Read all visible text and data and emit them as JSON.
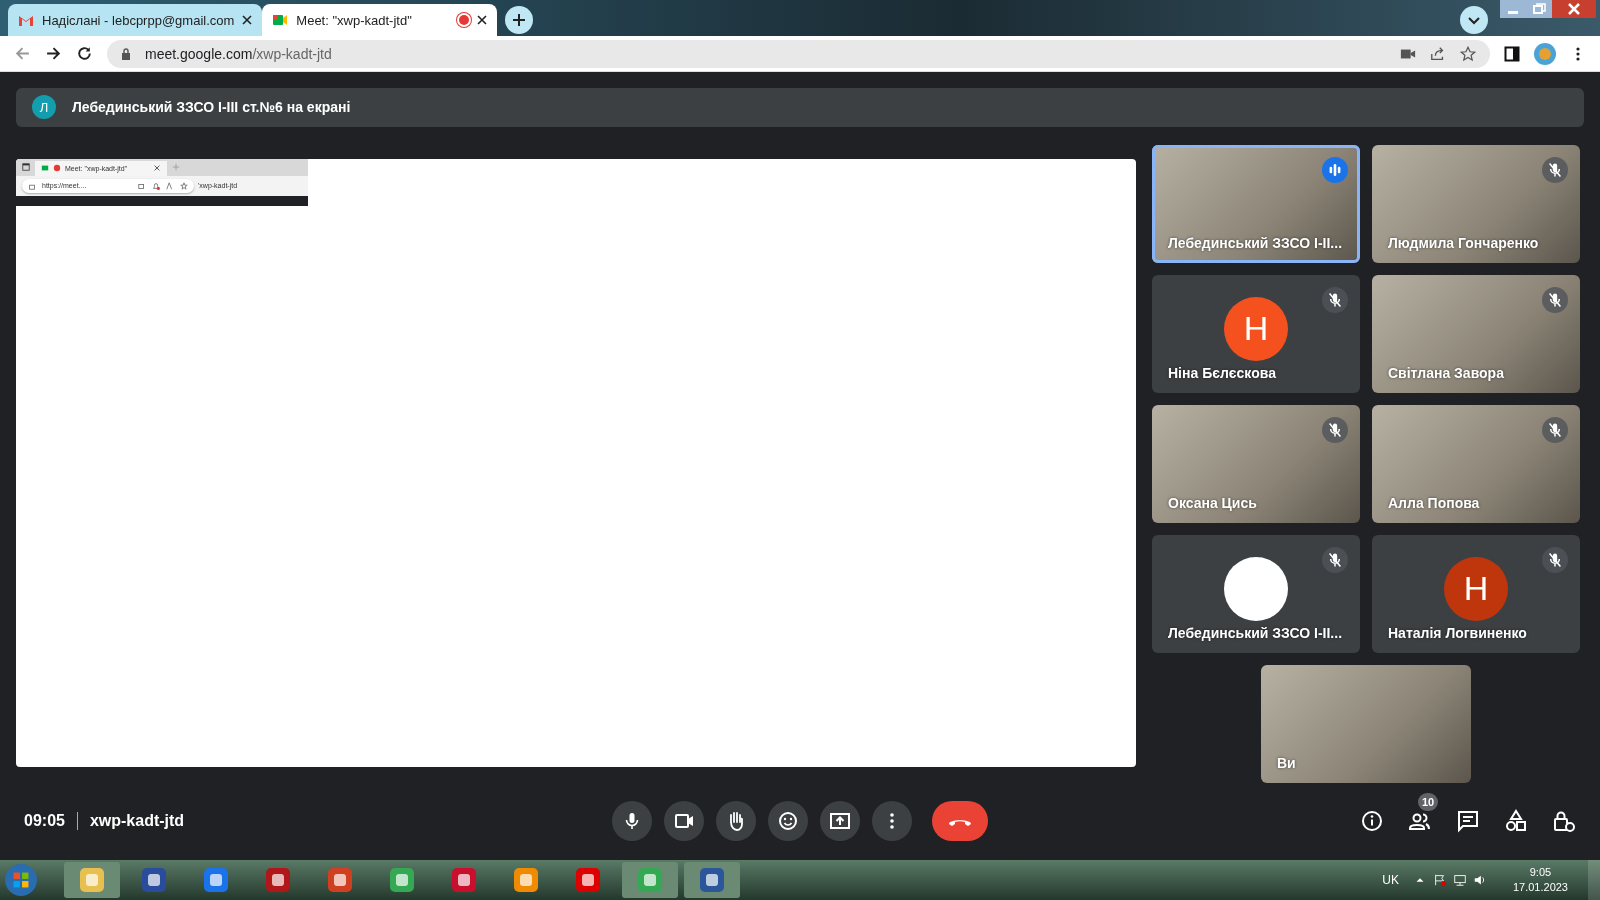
{
  "browser": {
    "tabs": [
      {
        "title": "Надіслані - lebcprpp@gmail.com",
        "kind": "mail",
        "recording": false,
        "selected": false
      },
      {
        "title": "Meet: \"xwp-kadt-jtd\"",
        "kind": "meet",
        "recording": true,
        "selected": true
      }
    ],
    "url_host": "meet.google.com",
    "url_path": "/xwp-kadt-jtd"
  },
  "presenting_banner": {
    "initial": "Л",
    "text": "Лебединський ЗЗСО І-ІІІ ст.№6 на екрані"
  },
  "shared_screen": {
    "tab_title": "Meet: \"xwp-kadt-jtd\"",
    "url": "https://meet....",
    "covered_url": "'xwp-kadt-jtd"
  },
  "participants": [
    {
      "name": "Лебединський ЗЗСО І-ІІ...",
      "kind": "video",
      "muted": false,
      "speaking": true
    },
    {
      "name": "Людмила Гончаренко",
      "kind": "video",
      "muted": true,
      "speaking": false
    },
    {
      "name": "Ніна Бєлєскова",
      "kind": "letter",
      "initial": "Н",
      "color": "#f4511e",
      "muted": true,
      "speaking": false
    },
    {
      "name": "Світлана Завора",
      "kind": "video",
      "muted": true,
      "speaking": false
    },
    {
      "name": "Оксана Цись",
      "kind": "video",
      "muted": true,
      "speaking": false
    },
    {
      "name": "Алла Попова",
      "kind": "video",
      "muted": true,
      "speaking": false
    },
    {
      "name": "Лебединський ЗЗСО І-ІІ...",
      "kind": "logo",
      "muted": true,
      "speaking": false
    },
    {
      "name": "Наталія Логвиненко",
      "kind": "letter",
      "initial": "Н",
      "color": "#bf360c",
      "muted": true,
      "speaking": false
    },
    {
      "name": "Ви",
      "kind": "video",
      "muted": false,
      "speaking": false
    }
  ],
  "meeting": {
    "time": "09:05",
    "code": "xwp-kadt-jtd",
    "people_count": "10"
  },
  "taskbar": {
    "language": "UK",
    "time": "9:05",
    "date": "17.01.2023"
  }
}
